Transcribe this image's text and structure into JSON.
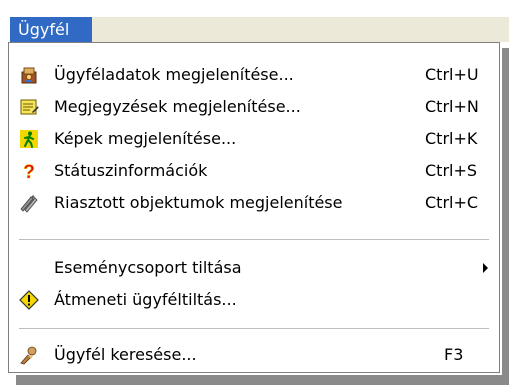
{
  "menu": {
    "title": "Ügyfél"
  },
  "items": [
    {
      "label": "Ügyféladatok megjelenítése...",
      "shortcut": "Ctrl+U",
      "icon": "customer-data-icon"
    },
    {
      "label": "Megjegyzések megjelenítése...",
      "shortcut": "Ctrl+N",
      "icon": "notes-icon"
    },
    {
      "label": "Képek megjelenítése...",
      "shortcut": "Ctrl+K",
      "icon": "images-icon"
    },
    {
      "label": "Státuszinformációk",
      "shortcut": "Ctrl+S",
      "icon": "question-mark-icon"
    },
    {
      "label": "Riasztott objektumok megjelenítése",
      "shortcut": "Ctrl+C",
      "icon": "alarmed-objects-icon"
    },
    {
      "label": "Eseménycsoport tiltása",
      "submenu": true
    },
    {
      "label": "Átmeneti ügyféltiltás...",
      "icon": "warning-icon"
    },
    {
      "label": "Ügyfél keresése...",
      "shortcut": "F3",
      "icon": "search-customer-icon"
    }
  ],
  "colors": {
    "highlight": "#316ac5",
    "menubar": "#ece9d8"
  }
}
